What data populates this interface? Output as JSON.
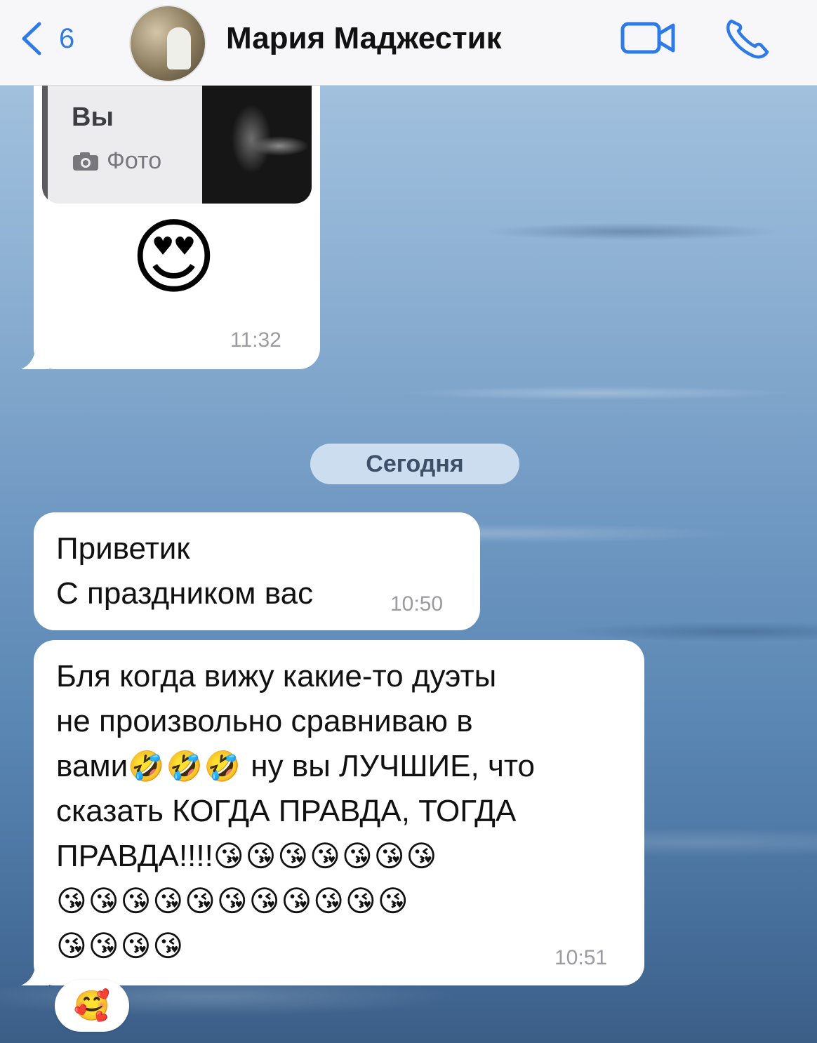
{
  "header": {
    "back_count": "6",
    "title": "Мария Маджестик",
    "icons": {
      "back": "chevron-left-icon",
      "video": "video-camera-icon",
      "phone": "phone-icon"
    },
    "accent_color": "#2e7ae6"
  },
  "messages": [
    {
      "reply": {
        "author": "Вы",
        "type": "Фото"
      },
      "emoji": "😍",
      "time": "11:32"
    },
    {
      "date_separator": "Сегодня"
    },
    {
      "lines": [
        "Приветик",
        "С праздником вас"
      ],
      "time": "10:50"
    },
    {
      "line1": "Бля когда вижу какие-то дуэты",
      "line2": "не произвольно сравниваю в",
      "line3_text": "вами",
      "line3_emoji": "🤣🤣🤣",
      "line3_rest": " ну вы ЛУЧШИЕ, что",
      "line4": "сказать КОГДА ПРАВДА, ТОГДА",
      "line5_text": "ПРАВДА!!!!",
      "line5_emoji": "😘😘😘😘😘😘😘",
      "line6_emoji": "😘😘😘😘😘😘😘😘😘😘😘",
      "line7_emoji": "😘😘😘😘",
      "time": "10:51",
      "reaction": "🥰"
    }
  ]
}
